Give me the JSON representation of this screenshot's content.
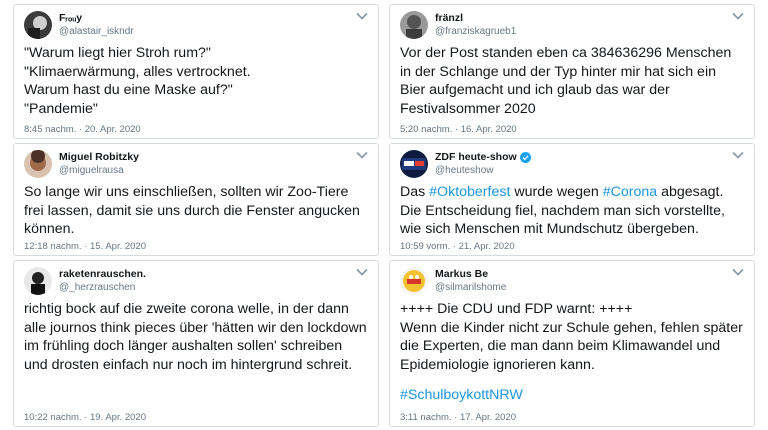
{
  "tweets": [
    {
      "name": "Fᵣₒᵤy",
      "handle": "@alastair_iskndr",
      "text": "\"Warum liegt hier Stroh rum?\"\n\"Klimaerwärmung, alles vertrocknet.\nWarum hast du eine Maske auf?\"\n\"Pandemie\"",
      "time": "8:45 nachm. · 20. Apr. 2020"
    },
    {
      "name": "fränzl",
      "handle": "@franziskagrueb1",
      "text": "Vor der Post standen eben ca 384636296 Menschen in der Schlange und der Typ hinter mir hat sich ein Bier aufgemacht und ich glaub das war der Festivalsommer 2020",
      "time": "5:20 nachm. · 16. Apr. 2020"
    },
    {
      "name": "Miguel Robitzky",
      "handle": "@miguelrausa",
      "text": "So lange wir uns einschließen, sollten wir Zoo-Tiere frei lassen, damit sie uns durch die Fenster angucken können.",
      "time": "12:18 nachm. · 15. Apr. 2020"
    },
    {
      "name": "ZDF heute-show",
      "handle": "@heuteshow",
      "text_parts": [
        "Das ",
        "#Oktoberfest",
        " wurde wegen ",
        "#Corona",
        " abgesagt.\nDie Entscheidung fiel, nachdem man sich vorstellte, wie sich Menschen mit Mundschutz übergeben."
      ],
      "time": "10:59 vorm. · 21. Apr. 2020"
    },
    {
      "name": "raketenrauschen.",
      "handle": "@_herzrauschen",
      "text": "richtig bock auf die zweite corona welle, in der dann alle journos think pieces über 'hätten wir den lockdown im frühling doch länger aushalten sollen' schreiben und drosten einfach nur noch im hintergrund schreit.",
      "time": "10:22 nachm. · 19. Apr. 2020"
    },
    {
      "name": "Markus Be",
      "handle": "@silmarilshome",
      "text": "++++ Die CDU und FDP warnt: ++++\nWenn die Kinder nicht zur Schule gehen, fehlen später die Experten, die man dann beim Klimawandel und Epidemiologie ignorieren kann.",
      "hashtag": "#SchulboykottNRW",
      "time": "3:11 nachm. · 17. Apr. 2020"
    }
  ],
  "colors": {
    "link": "#1b95e0",
    "muted": "#657786",
    "border": "#d6dbe0"
  }
}
